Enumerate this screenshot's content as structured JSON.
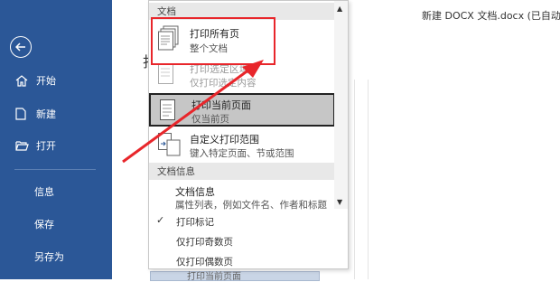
{
  "window": {
    "title": "新建 DOCX 文档.docx (已自动保"
  },
  "nav": {
    "items": [
      {
        "label": "开始",
        "icon": "home-icon"
      },
      {
        "label": "新建",
        "icon": "new-doc-icon"
      },
      {
        "label": "打开",
        "icon": "folder-open-icon"
      },
      {
        "label": "信息"
      },
      {
        "label": "保存"
      },
      {
        "label": "另存为"
      }
    ]
  },
  "dropdown": {
    "section1": "文档",
    "options": [
      {
        "title": "打印所有页",
        "desc": "整个文档"
      },
      {
        "title": "打印选定区域",
        "desc": "仅打印选定内容"
      },
      {
        "title": "打印当前页面",
        "desc": "仅当前页"
      },
      {
        "title": "自定义打印范围",
        "desc": "键入特定页面、节或范围"
      }
    ],
    "section2": "文档信息",
    "info": {
      "title": "文档信息",
      "desc": "属性列表，例如文件名、作者和标题"
    },
    "checks": [
      {
        "label": "打印标记",
        "checked": true
      },
      {
        "label": "仅打印奇数页",
        "checked": false
      },
      {
        "label": "仅打印偶数页",
        "checked": false
      }
    ]
  },
  "bottom_selector": {
    "label": "打印当前页面"
  },
  "fragment": "打",
  "colors": {
    "nav_bg": "#2b5797",
    "highlight": "#e8262b",
    "selected_bg": "#c6c6c6"
  }
}
